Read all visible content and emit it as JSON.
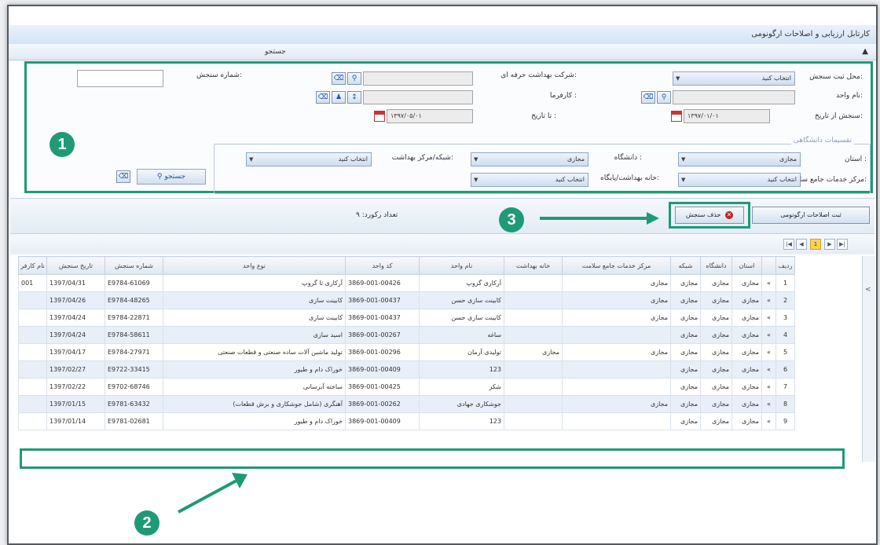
{
  "window": {
    "title": "کارتابل ارزیابی و اصلاحات ارگونومی",
    "tab_label": "جستجو",
    "collapse_icon": "chevron-up-icon"
  },
  "search": {
    "place_label": "محل ثبت سنجش:",
    "place_value": "انتخاب کنید",
    "company_label": "شرکت بهداشت حرفه ای:",
    "measure_no_label": "شماره سنجش:",
    "unit_label": "نام واحد:",
    "employer_label": "کارفرما :",
    "from_date_label": "سنجش از تاریخ:",
    "from_date_value": "۱۳۹۷/۰۱/۰۱",
    "to_date_label": "تا تاریخ :",
    "to_date_value": "۱۳۹۷/۰۵/۰۱",
    "fieldset_title": "تقسیمات دانشگاهی",
    "province_label": "استان :",
    "province_value": "مجازی",
    "university_label": "دانشگاه :",
    "university_value": "مجازی",
    "network_label": "شبکه/مرکز بهداشت:",
    "network_value": "انتخاب کنید",
    "center_label": "مرکز خدمات جامع سلامت:",
    "center_value": "انتخاب کنید",
    "house_label": "خانه بهداشت/پایگاه:",
    "house_value": "انتخاب کنید",
    "search_button": "جستجو"
  },
  "toolbar": {
    "register_button": "ثبت اصلاحات ارگونومی",
    "delete_button": "حذف سنجش",
    "record_count": "تعداد رکورد: ۹"
  },
  "annotations": {
    "badge1": "1",
    "badge2": "2",
    "badge3": "3"
  },
  "grid": {
    "columns": [
      "ردیف",
      "استان",
      "دانشگاه",
      "شبکه",
      "مرکز خدمات جامع سلامت",
      "خانه بهداشت",
      "نام واحد",
      "کد واحد",
      "نوع واحد",
      "شماره سنجش",
      "تاریخ سنجش",
      "نام کارفر"
    ],
    "rows": [
      {
        "n": "1",
        "prov": "مجازی",
        "uni": "مجازی",
        "net": "مجازی",
        "center": "مجازی",
        "house": "",
        "uname": "آرکاری گروپ",
        "ucode": "3869-001-00426",
        "utype": "آرکاری تا گروپ",
        "mno": "E9784-61069",
        "date": "1397/04/31",
        "emp": "001"
      },
      {
        "n": "2",
        "prov": "مجازی",
        "uni": "مجازی",
        "net": "مجازی",
        "center": "مجازی",
        "house": "",
        "uname": "کابینت سازی حسن",
        "ucode": "3869-001-00437",
        "utype": "کابینت سازی",
        "mno": "E9784-48265",
        "date": "1397/04/26",
        "emp": ""
      },
      {
        "n": "3",
        "prov": "مجازی",
        "uni": "مجازی",
        "net": "مجازی",
        "center": "مجازی",
        "house": "",
        "uname": "کابینت سازی حسن",
        "ucode": "3869-001-00437",
        "utype": "کابینت سازی",
        "mno": "E9784-22871",
        "date": "1397/04/24",
        "emp": ""
      },
      {
        "n": "4",
        "prov": "مجازی",
        "uni": "مجازی",
        "net": "مجازی",
        "center": "",
        "house": "",
        "uname": "ساغه",
        "ucode": "3869-001-00267",
        "utype": "اسید سازی",
        "mno": "E9784-58611",
        "date": "1397/04/24",
        "emp": ""
      },
      {
        "n": "5",
        "prov": "مجازی",
        "uni": "مجازی",
        "net": "مجازی",
        "center": "مجازی",
        "house": "مجازی",
        "uname": "تولیدی آرمان",
        "ucode": "3869-001-00296",
        "utype": "تولید ماشین آلات ساده صنعتی و قطعات صنعتی",
        "mno": "E9784-27971",
        "date": "1397/04/17",
        "emp": ""
      },
      {
        "n": "6",
        "prov": "مجازی",
        "uni": "مجازی",
        "net": "مجازی",
        "center": "",
        "house": "",
        "uname": "123",
        "ucode": "3869-001-00409",
        "utype": "خوراک دام و طیور",
        "mno": "E9722-33415",
        "date": "1397/02/27",
        "emp": ""
      },
      {
        "n": "7",
        "prov": "مجازی",
        "uni": "مجازی",
        "net": "مجازی",
        "center": "",
        "house": "",
        "uname": "شکر",
        "ucode": "3869-001-00425",
        "utype": "ساخته آبرسانی",
        "mno": "E9702-68746",
        "date": "1397/02/22",
        "emp": ""
      },
      {
        "n": "8",
        "prov": "مجازی",
        "uni": "مجازی",
        "net": "مجازی",
        "center": "مجازی",
        "house": "",
        "uname": "جوشکاری جهادی",
        "ucode": "3869-001-00262",
        "utype": "آهنگری (شامل جوشکاری و برش قطعات)",
        "mno": "E9781-63432",
        "date": "1397/01/15",
        "emp": ""
      },
      {
        "n": "9",
        "prov": "مجازی",
        "uni": "مجازی",
        "net": "مجازی",
        "center": "",
        "house": "",
        "uname": "123",
        "ucode": "3869-001-00409",
        "utype": "خوراک دام و طیور",
        "mno": "E9781-02681",
        "date": "1397/01/14",
        "emp": ""
      }
    ]
  },
  "colors": {
    "annotation_green": "#1e9a77",
    "header_blue": "#d3e3f4",
    "row_alt": "#e8eff8"
  }
}
